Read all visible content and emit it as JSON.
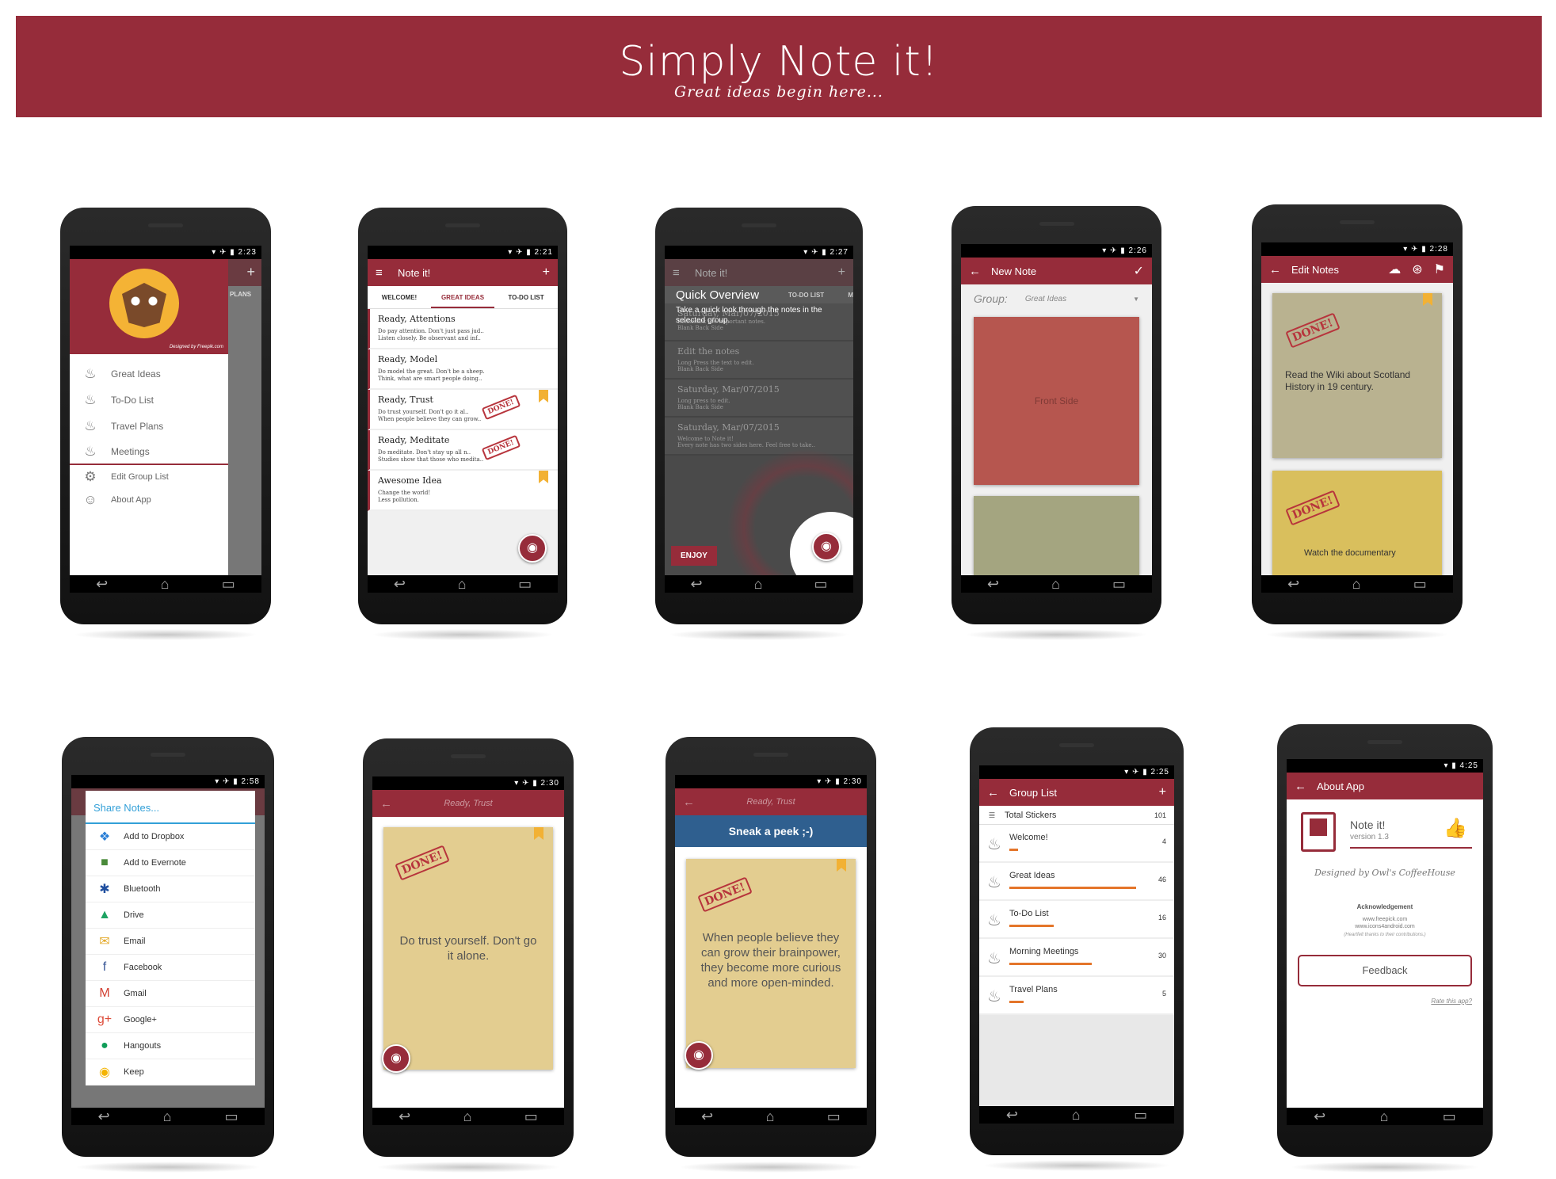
{
  "banner": {
    "title": "Simply Note it!",
    "subtitle": "Great ideas begin here..."
  },
  "nav_icons": {
    "back": "↩",
    "home": "⌂",
    "recent": "▭"
  },
  "colors": {
    "brand": "#962c3a",
    "accent": "#e4752a",
    "bookmark": "#f2b134"
  },
  "s1": {
    "time": "2:23",
    "credit": "Designed by Freepik.com",
    "bg_tab": "PLANS",
    "groups": [
      "Great Ideas",
      "To-Do List",
      "Travel Plans",
      "Meetings"
    ],
    "menu": [
      "Edit Group List",
      "About App"
    ]
  },
  "s2": {
    "time": "2:21",
    "title": "Note it!",
    "tabs": [
      "WELCOME!",
      "GREAT IDEAS",
      "TO-DO LIST"
    ],
    "notes": [
      {
        "title": "Ready, Attentions",
        "body": "Do pay attention. Don't just pass jud..\nListen closely. Be observant and inf.."
      },
      {
        "title": "Ready, Model",
        "body": "Do model the great. Don't be a sheep.\nThink, what are smart people doing.."
      },
      {
        "title": "Ready, Trust",
        "body": "Do trust yourself. Don't go it al..\nWhen people believe they can grow.."
      },
      {
        "title": "Ready, Meditate",
        "body": "Do meditate. Don't stay up all n..\nStudies show that those who medita.."
      },
      {
        "title": "Awesome Idea",
        "body": "Change the world!\nLess pollution."
      }
    ]
  },
  "done": "DONE!",
  "s3": {
    "time": "2:27",
    "title": "Note it!",
    "tab": "TO-DO LIST",
    "tab_cut": "M",
    "ov_title": "Quick Overview",
    "ov_text": "Take a quick look through the notes in the selected group.",
    "rows": [
      {
        "title": "Saturday, Mar/07/2015",
        "body": "Bookmark the important notes.\nBlank Back Side"
      },
      {
        "title": "Edit the notes",
        "body": "Long Press the text to edit.\nBlank Back Side"
      },
      {
        "title": "Saturday, Mar/07/2015",
        "body": "Long press to edit.\nBlank Back Side"
      },
      {
        "title": "Saturday, Mar/07/2015",
        "body": "Welcome to Note it!\nEvery note has two sides here. Feel free to take.."
      }
    ],
    "enjoy": "ENJOY"
  },
  "s4": {
    "time": "2:26",
    "title": "New Note",
    "group_label": "Group:",
    "group_value": "Great Ideas",
    "front": "Front Side"
  },
  "s5": {
    "time": "2:28",
    "title": "Edit Notes",
    "note": "Read the Wiki about Scotland History in 19 century.",
    "cut": "Watch the documentary"
  },
  "s6": {
    "time": "2:58",
    "title": "Share Notes...",
    "items": [
      "Add to Dropbox",
      "Add to Evernote",
      "Bluetooth",
      "Drive",
      "Email",
      "Facebook",
      "Gmail",
      "Google+",
      "Hangouts",
      "Keep"
    ]
  },
  "s7": {
    "time": "2:30",
    "title": "Ready, Trust",
    "note": "Do trust yourself. Don't go it alone."
  },
  "s8": {
    "time": "2:30",
    "title": "Ready, Trust",
    "peek": "Sneak a peek ;-)",
    "note": "When people believe they can grow their brainpower, they become more curious and more open-minded."
  },
  "s9": {
    "time": "2:25",
    "title": "Group List",
    "total_label": "Total Stickers",
    "total": "101",
    "groups": [
      {
        "name": "Welcome!",
        "count": "4",
        "pct": 7
      },
      {
        "name": "Great Ideas",
        "count": "46",
        "pct": 100
      },
      {
        "name": "To-Do List",
        "count": "16",
        "pct": 35
      },
      {
        "name": "Morning Meetings",
        "count": "30",
        "pct": 65
      },
      {
        "name": "Travel Plans",
        "count": "5",
        "pct": 11
      }
    ]
  },
  "s10": {
    "time": "4:25",
    "title": "About App",
    "app": "Note it!",
    "version": "version 1.3",
    "designed": "Designed by Owl's CoffeeHouse",
    "ack": "Acknowledgement",
    "links": [
      "www.freepick.com",
      "www.icons4android.com"
    ],
    "thanks": "(Heartfelt thanks to their contributions.)",
    "feedback": "Feedback",
    "rate": "Rate this app?"
  }
}
